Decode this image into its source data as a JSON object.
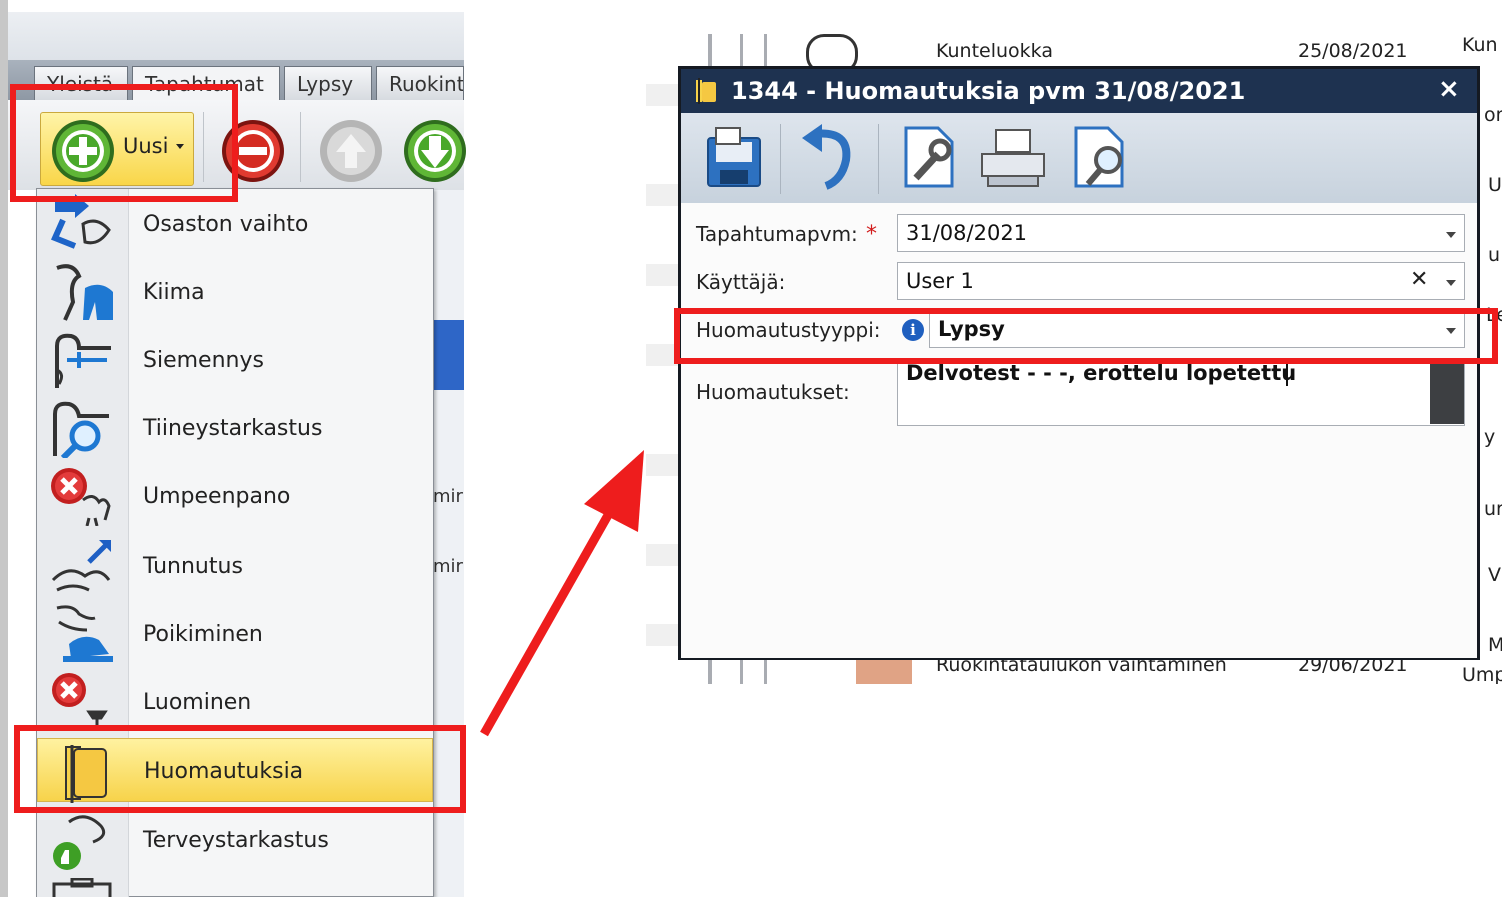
{
  "left_app": {
    "tabs": [
      "Yleistä",
      "Tapahtumat",
      "Lypsy",
      "Ruokint"
    ],
    "active_tab": "Tapahtumat",
    "toolbar": {
      "new_label": "Uusi",
      "buttons": [
        "add-icon",
        "remove-icon",
        "up-arrow-icon",
        "down-arrow-icon"
      ]
    },
    "menu_items": [
      {
        "label": "Osaston vaihto",
        "icon": "transfer-icon"
      },
      {
        "label": "Kiima",
        "icon": "heat-icon"
      },
      {
        "label": "Siemennys",
        "icon": "insemination-icon"
      },
      {
        "label": "Tiineystarkastus",
        "icon": "pregnancy-check-icon"
      },
      {
        "label": "Umpeenpano",
        "icon": "dry-off-icon"
      },
      {
        "label": "Tunnutus",
        "icon": "induction-icon"
      },
      {
        "label": "Poikiminen",
        "icon": "calving-icon"
      },
      {
        "label": "Luominen",
        "icon": "abortion-icon"
      },
      {
        "label": "Huomautuksia",
        "icon": "notes-icon",
        "highlighted": true
      },
      {
        "label": "Terveystarkastus",
        "icon": "health-check-icon"
      }
    ],
    "background_fragments": [
      "mir",
      "mir"
    ]
  },
  "background_list": {
    "fragments_top": [
      "Kunteluokka",
      "25/08/2021",
      "Kun"
    ],
    "fragments_bottom": [
      "Ruokintataulukon vaihtaminen",
      "29/06/2021",
      "Ump"
    ],
    "right_column_fragments": [
      "on",
      "U",
      "u",
      "Le",
      "y",
      "ur",
      "V",
      "M"
    ]
  },
  "dialog": {
    "title": "1344 - Huomautuksia pvm 31/08/2021",
    "close_glyph": "×",
    "toolbar_icons": [
      "save-icon",
      "undo-icon",
      "settings-icon",
      "print-icon",
      "preview-icon"
    ],
    "fields": {
      "event_date": {
        "label": "Tapahtumapvm:",
        "required_mark": "*",
        "value": "31/08/2021"
      },
      "user": {
        "label": "Käyttäjä:",
        "value": "User 1",
        "clear_glyph": "✕"
      },
      "note_type": {
        "label": "Huomautustyyppi:",
        "info_glyph": "i",
        "value": "Lypsy"
      },
      "notes": {
        "label": "Huomautukset:",
        "value": "Delvotest - - -, erottelu lopetettu"
      }
    }
  },
  "colors": {
    "callout": "#ee1d1d",
    "dialog_titlebar": "#1e3250",
    "menu_highlight": "#f7d34a"
  }
}
